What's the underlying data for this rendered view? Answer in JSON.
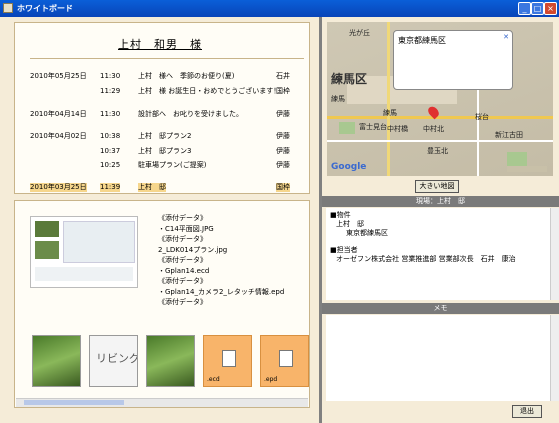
{
  "window": {
    "title": "ホワイトボード",
    "minimize": "_",
    "maximize": "□",
    "close": "×"
  },
  "customer": {
    "name": "上村　和男　様"
  },
  "history": [
    {
      "date": "2010年05月25日",
      "time": "11:30",
      "text": "上村　様へ　季節のお便り(夏)",
      "staff": "石井",
      "highlight": false
    },
    {
      "date": "",
      "time": "11:29",
      "text": "上村　様 お誕生日・おめでとうございます！",
      "staff": "国枠",
      "highlight": false
    },
    {
      "date": "2010年04月14日",
      "time": "11:30",
      "text": "設計部へ　お叱りを受けました。",
      "staff": "伊藤",
      "highlight": false
    },
    {
      "date": "2010年04月02日",
      "time": "10:38",
      "text": "上村　邸プラン2",
      "staff": "伊藤",
      "highlight": false
    },
    {
      "date": "",
      "time": "10:37",
      "text": "上村　邸プラン3",
      "staff": "伊藤",
      "highlight": false
    },
    {
      "date": "",
      "time": "10:25",
      "text": "駐車場プラン(ご提案)",
      "staff": "伊藤",
      "highlight": false
    },
    {
      "date": "2010年03月25日",
      "time": "11:39",
      "text": "上村　邸",
      "staff": "国枠",
      "highlight": true
    }
  ],
  "attachments": {
    "lines": [
      "《添付データ》",
      "・C14平面図.JPG",
      "《添付データ》",
      "2_LDK014プラン.jpg",
      "《添付データ》",
      "・Gplan14.ecd",
      "《添付データ》",
      "・Gplan14_カメラ2_レタッチ情報.epd",
      "《添付データ》"
    ],
    "thumbs": [
      {
        "kind": "photo",
        "label": ""
      },
      {
        "kind": "text",
        "label": "リビング"
      },
      {
        "kind": "photo",
        "label": ""
      },
      {
        "kind": "file",
        "label": ".ecd"
      },
      {
        "kind": "file",
        "label": ".epd"
      }
    ]
  },
  "map": {
    "bubble_text": "東京都練馬区",
    "district": "練馬区",
    "logo": "Google",
    "enlarge_button": "大きい地図",
    "place_labels": [
      "光が丘",
      "練馬",
      "富士見台",
      "中村橋",
      "練馬",
      "中村北",
      "豊玉北",
      "桜台",
      "新江古田"
    ]
  },
  "info": {
    "header": "現場：上村　邸",
    "sections": [
      {
        "title": "■物件",
        "lines": [
          "上村　邸",
          "東京都練馬区"
        ]
      },
      {
        "title": "■担当者",
        "lines": [
          "オーゼフン株式会社 営業推進部 営業部次長　石井　康治"
        ]
      }
    ],
    "memo_header": "メモ",
    "close_button": "退出"
  },
  "colors": {
    "titlebar": "#0a5fd8",
    "frame": "#f5ecd8",
    "highlight": "#f6d68c",
    "file_thumb": "#f8b46a"
  }
}
